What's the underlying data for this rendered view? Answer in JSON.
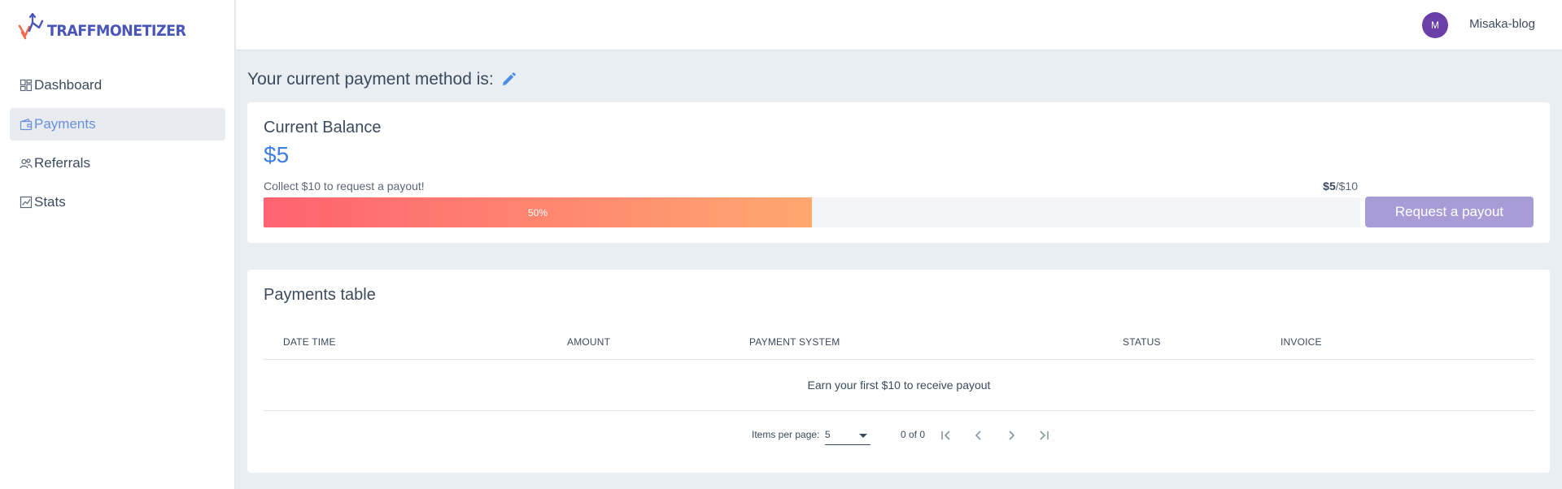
{
  "brand": {
    "name": "TRAFFMONETIZER",
    "accent_orange": "#f26b4f",
    "accent_blue": "#4a55b8"
  },
  "sidebar": {
    "items": [
      {
        "label": "Dashboard",
        "icon": "dashboard-icon",
        "active": false
      },
      {
        "label": "Payments",
        "icon": "wallet-icon",
        "active": true
      },
      {
        "label": "Referrals",
        "icon": "users-icon",
        "active": false
      },
      {
        "label": "Stats",
        "icon": "chart-icon",
        "active": false
      }
    ]
  },
  "header": {
    "avatar_initial": "M",
    "username": "Misaka-blog",
    "avatar_color": "#6a3fa8"
  },
  "page": {
    "title": "Your current payment method is:"
  },
  "balance": {
    "title": "Current Balance",
    "amount": "$5",
    "collect_text": "Collect $10 to request a payout!",
    "current": "$5",
    "target": "/$10",
    "progress_label": "50%",
    "progress_value": 0.5,
    "payout_button": "Request a payout"
  },
  "payments_table": {
    "title": "Payments table",
    "columns": [
      "DATE TIME",
      "AMOUNT",
      "PAYMENT SYSTEM",
      "STATUS",
      "INVOICE"
    ],
    "empty_message": "Earn your first $10 to receive payout",
    "paginator": {
      "items_per_page_label": "Items per page:",
      "items_per_page": "5",
      "range": "0 of 0"
    }
  }
}
